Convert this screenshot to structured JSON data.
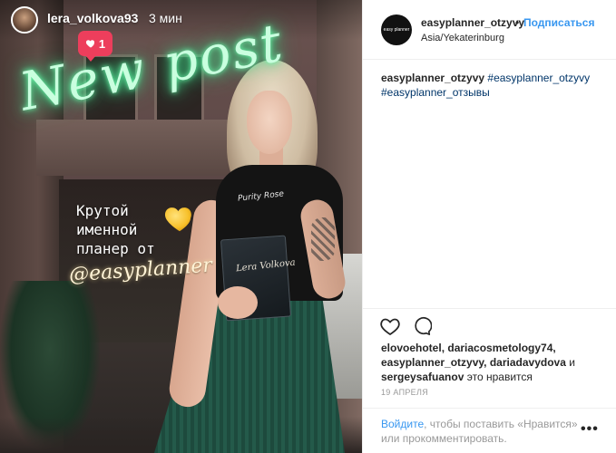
{
  "story": {
    "username": "lera_volkova93",
    "time": "3 мин",
    "like_count": "1",
    "neon_text": "New post",
    "caption_lines": [
      "Крутой",
      "именной",
      "планер от"
    ],
    "mention": "@easyplanner",
    "shirt_text": "Purity Rose",
    "planner_text": "Lera Volkova"
  },
  "post": {
    "avatar_text": "easy planner",
    "username": "easyplanner_otzyvy",
    "separator": "•",
    "follow_label": "Подписаться",
    "location": "Asia/Yekaterinburg",
    "comment_user": "easyplanner_otzyvy",
    "tags": [
      "#easyplanner_otzyvy",
      "#easyplanner_отзывы"
    ]
  },
  "likes": {
    "users": [
      "elovoehotel",
      "dariacosmetology74",
      "easyplanner_otzyvy",
      "dariadavydova",
      "sergeysafuanov"
    ],
    "and": "и",
    "suffix": "это нравится"
  },
  "date": "19 АПРЕЛЯ",
  "login": {
    "link": "Войдите",
    "text": ", чтобы поставить «Нравится» или прокомментировать.",
    "more": "•••"
  },
  "colors": {
    "accent": "#3897f0",
    "like_badge": "#ed3e5c",
    "neon": "#3ee08a"
  }
}
